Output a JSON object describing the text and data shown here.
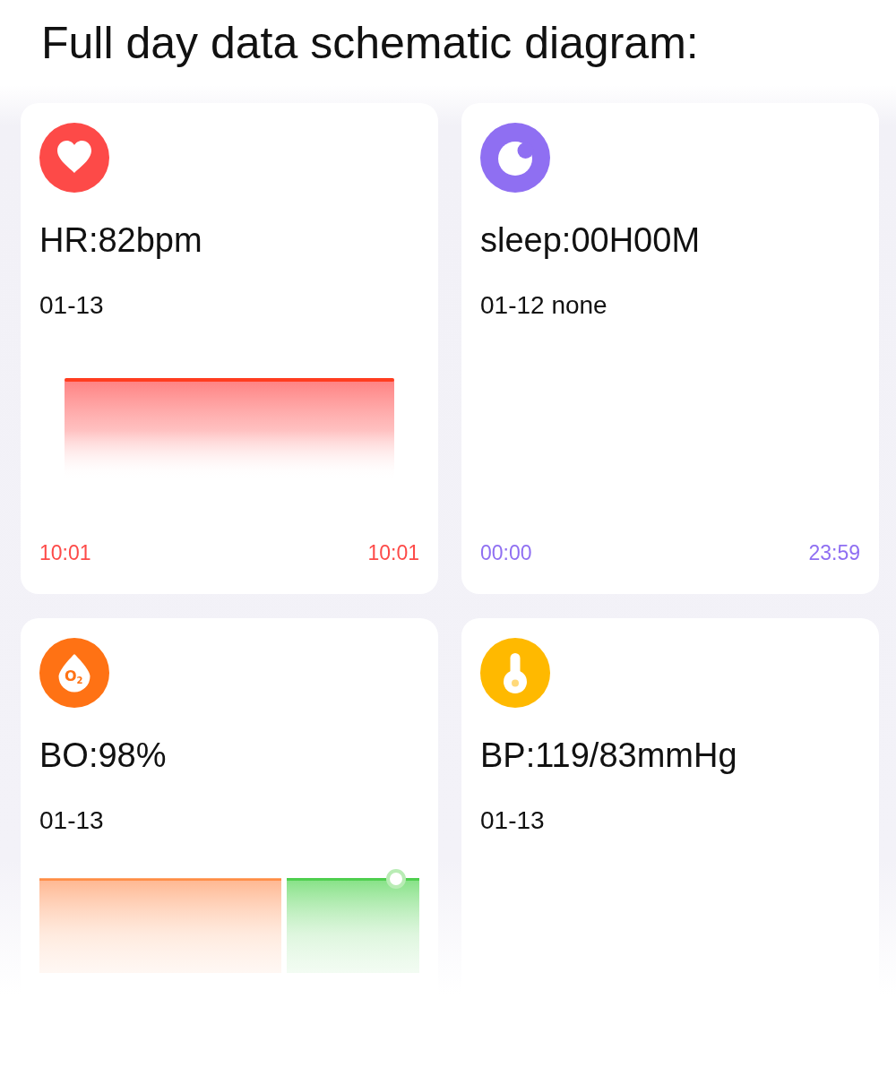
{
  "title": "Full day data schematic diagram:",
  "cards": [
    {
      "kind": "heart_rate",
      "color": "#fd4a48",
      "value": "HR:82bpm",
      "date": "01-13",
      "axis_labels": [
        "10:01",
        "10:01"
      ]
    },
    {
      "kind": "sleep",
      "color": "#8f6ff2",
      "value": "sleep:00H00M",
      "date": "01-12 none",
      "axis_labels": [
        "00:00",
        "23:59"
      ]
    },
    {
      "kind": "blood_oxygen",
      "color": "#ff7214",
      "value": "BO:98%",
      "date": "01-13",
      "icon_label": "O$_{2}$"
    },
    {
      "kind": "blood_pressure",
      "color": "#ffb900",
      "value": "BP:119/83mmHg",
      "date": "01-13"
    }
  ]
}
